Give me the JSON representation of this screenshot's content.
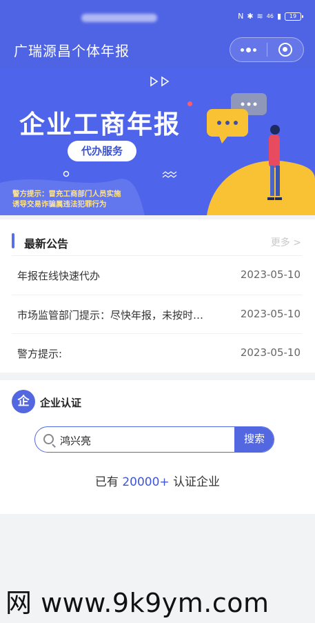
{
  "status_bar": {
    "mini_text": "46",
    "battery": "19"
  },
  "nav": {
    "title": "广瑞源昌个体年报",
    "menu_icon": "more-dots-icon",
    "close_icon": "target-close-icon"
  },
  "banner": {
    "title": "企业工商年报",
    "service_label": "代办服务",
    "warning_line1": "警方提示：冒充工商部门人员实施",
    "warning_line2": "诱导交易诈骗属违法犯罪行为"
  },
  "notice": {
    "title": "最新公告",
    "more_label": "更多 >",
    "items": [
      {
        "text": "年报在线快速代办",
        "date": "2023-05-10"
      },
      {
        "text": "市场监管部门提示：尽快年报，未按时…",
        "date": "2023-05-10"
      },
      {
        "text": "警方提示:",
        "date": "2023-05-10"
      }
    ]
  },
  "certification": {
    "icon_char": "企",
    "title": "企业认证",
    "search_value": "鸿兴亮",
    "search_button": "搜索",
    "stat_prefix": "已有",
    "stat_count": "20000+",
    "stat_suffix": "认证企业"
  },
  "watermark": "网 www.9k9ym.com",
  "colors": {
    "primary": "#4f63e5",
    "accent": "#5367e0",
    "banner_yellow": "#f9c234",
    "page_bg": "#f2f3f5"
  }
}
